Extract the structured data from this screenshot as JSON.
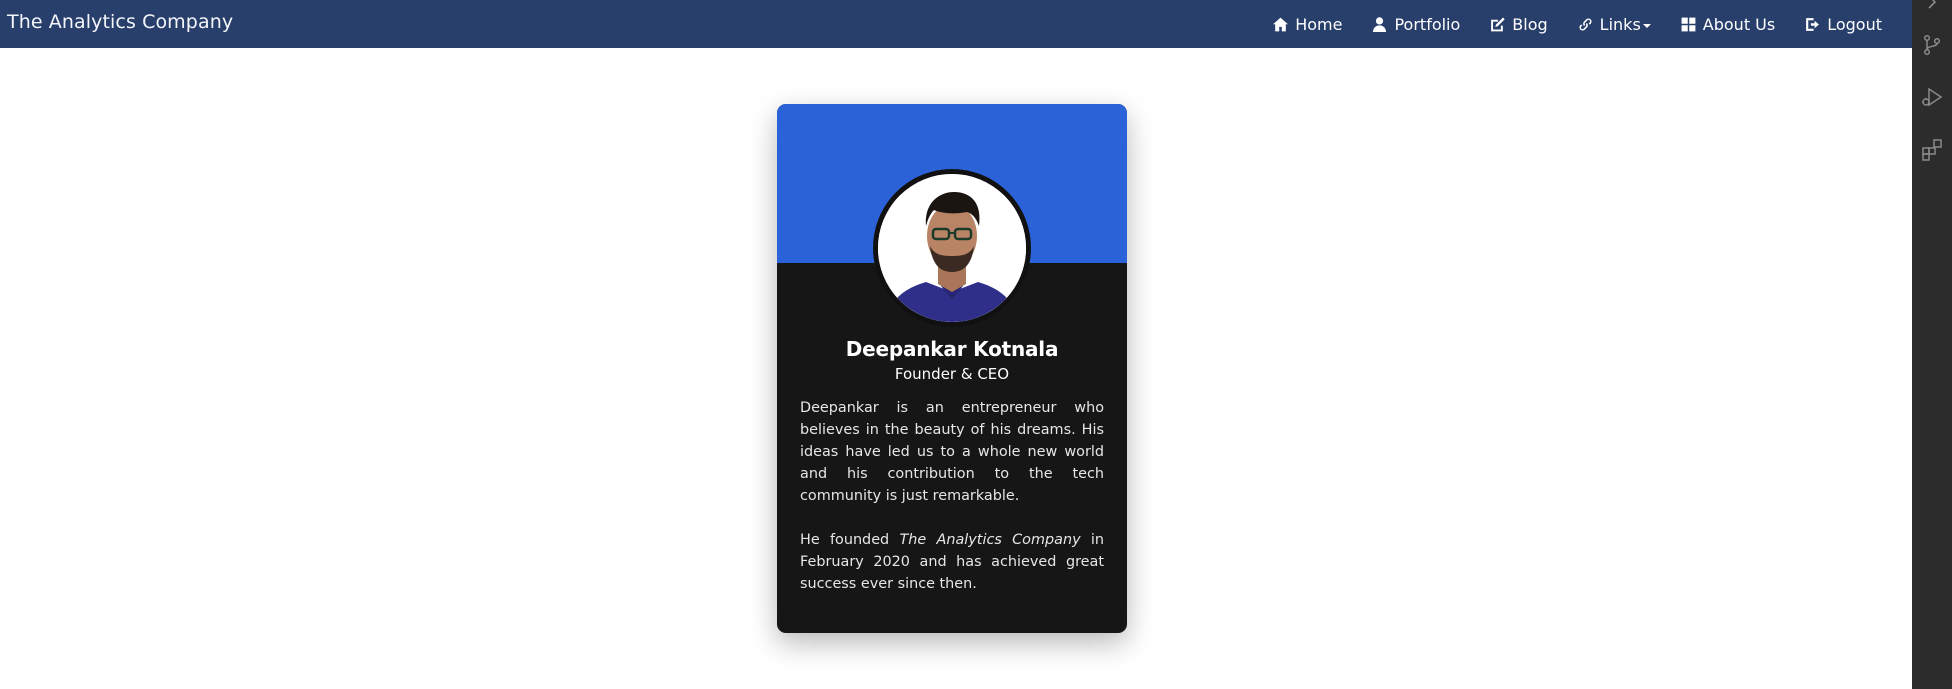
{
  "navbar": {
    "brand": "The Analytics Company",
    "items": [
      {
        "label": "Home",
        "icon": "home-icon"
      },
      {
        "label": "Portfolio",
        "icon": "user-icon"
      },
      {
        "label": "Blog",
        "icon": "edit-icon"
      },
      {
        "label": "Links",
        "icon": "link-icon",
        "dropdown": true
      },
      {
        "label": "About Us",
        "icon": "grid-icon"
      },
      {
        "label": "Logout",
        "icon": "logout-icon"
      }
    ],
    "background_color": "#283e6b"
  },
  "card": {
    "name": "Deepankar Kotnala",
    "role": "Founder & CEO",
    "bio_paragraph_1": "Deepankar is an entrepreneur who believes in the beauty of his dreams. His ideas have led us to a whole new world and his contribution to the tech community is just remarkable.",
    "bio_paragraph_2_prefix": "He founded ",
    "bio_paragraph_2_company": "The Analytics Company",
    "bio_paragraph_2_suffix": " in February 2020 and has achieved great success ever since then.",
    "header_color": "#2b62d8",
    "body_color": "#161616"
  },
  "activity_bar": {
    "icons": [
      "chevron-right-icon",
      "source-control-icon",
      "run-debug-icon",
      "extensions-icon"
    ]
  }
}
